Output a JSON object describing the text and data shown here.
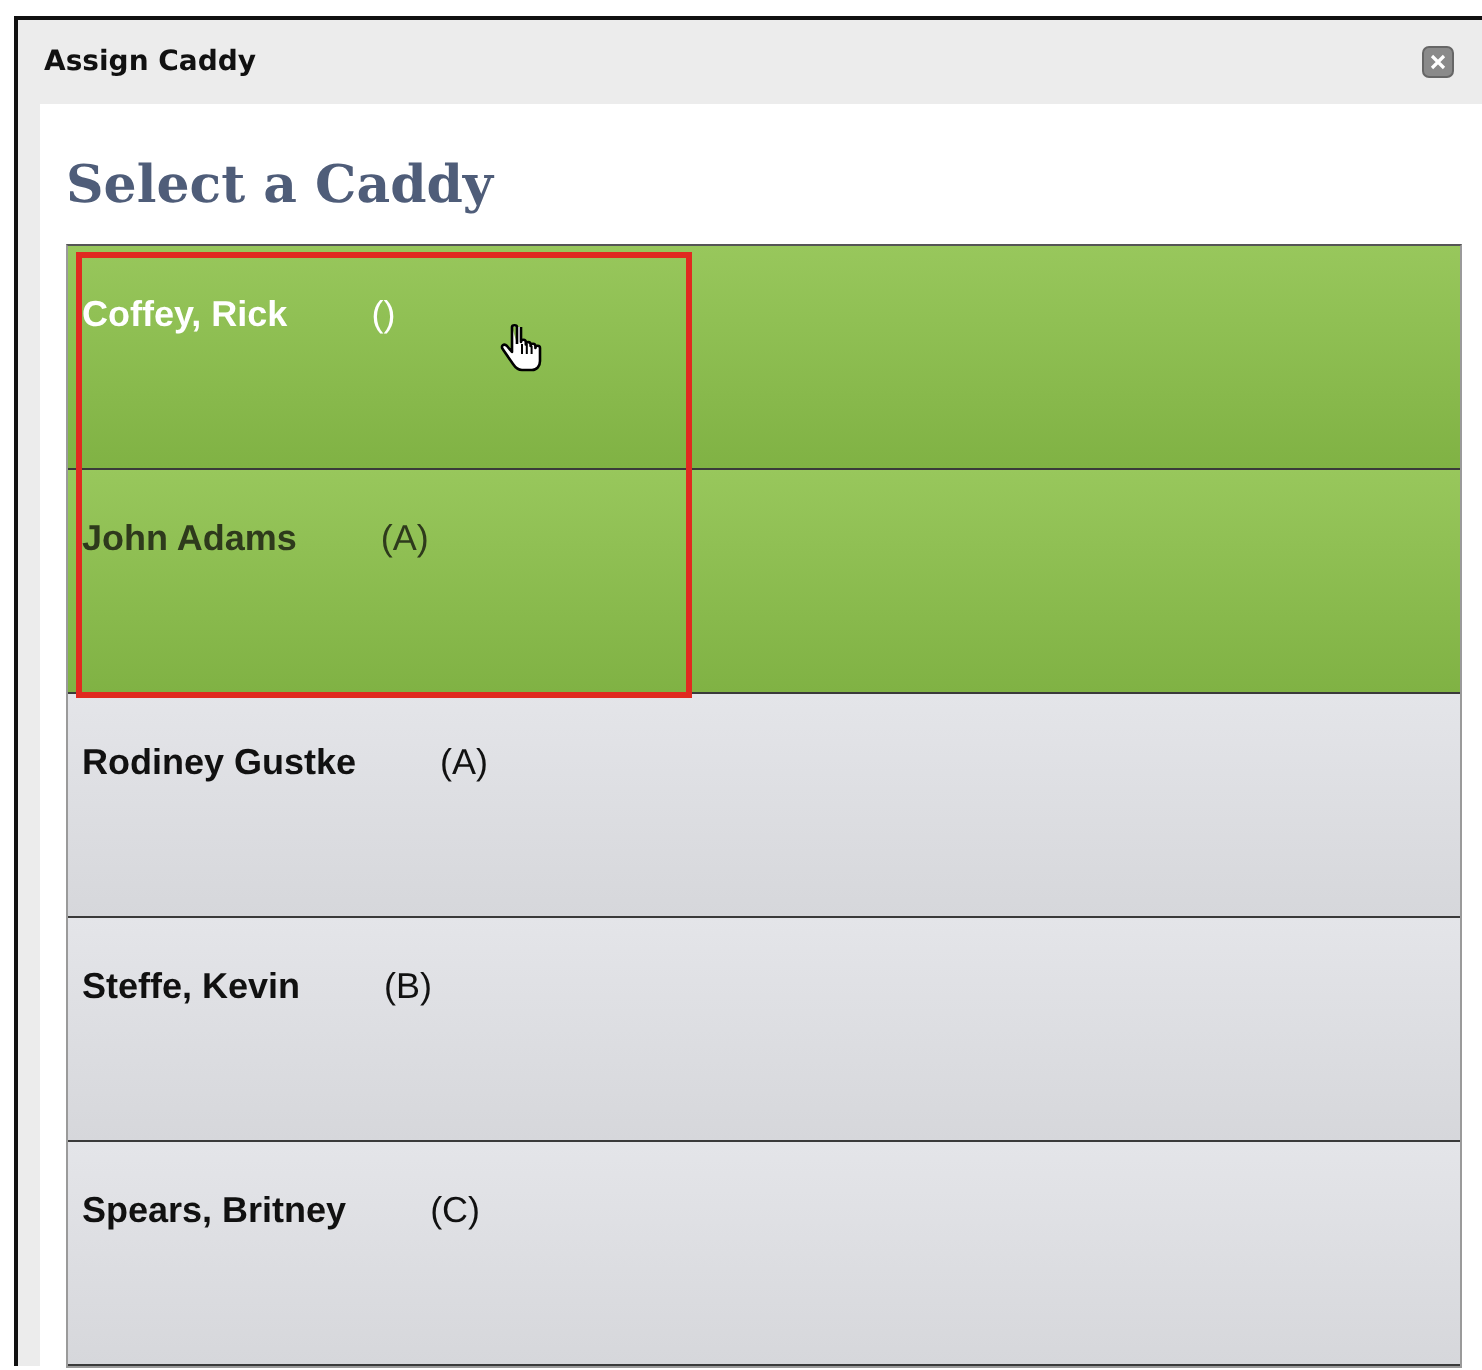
{
  "window": {
    "title": "Assign Caddy"
  },
  "heading": "Select a Caddy",
  "caddies": [
    {
      "name": "Coffey, Rick",
      "grade": "()",
      "selected": true,
      "hovered": true
    },
    {
      "name": "John Adams",
      "grade": "(A)",
      "selected": true,
      "hovered": false
    },
    {
      "name": "Rodiney Gustke",
      "grade": "(A)",
      "selected": false,
      "hovered": false
    },
    {
      "name": "Steffe, Kevin",
      "grade": "(B)",
      "selected": false,
      "hovered": false
    },
    {
      "name": "Spears, Britney",
      "grade": "(C)",
      "selected": false,
      "hovered": false
    }
  ]
}
